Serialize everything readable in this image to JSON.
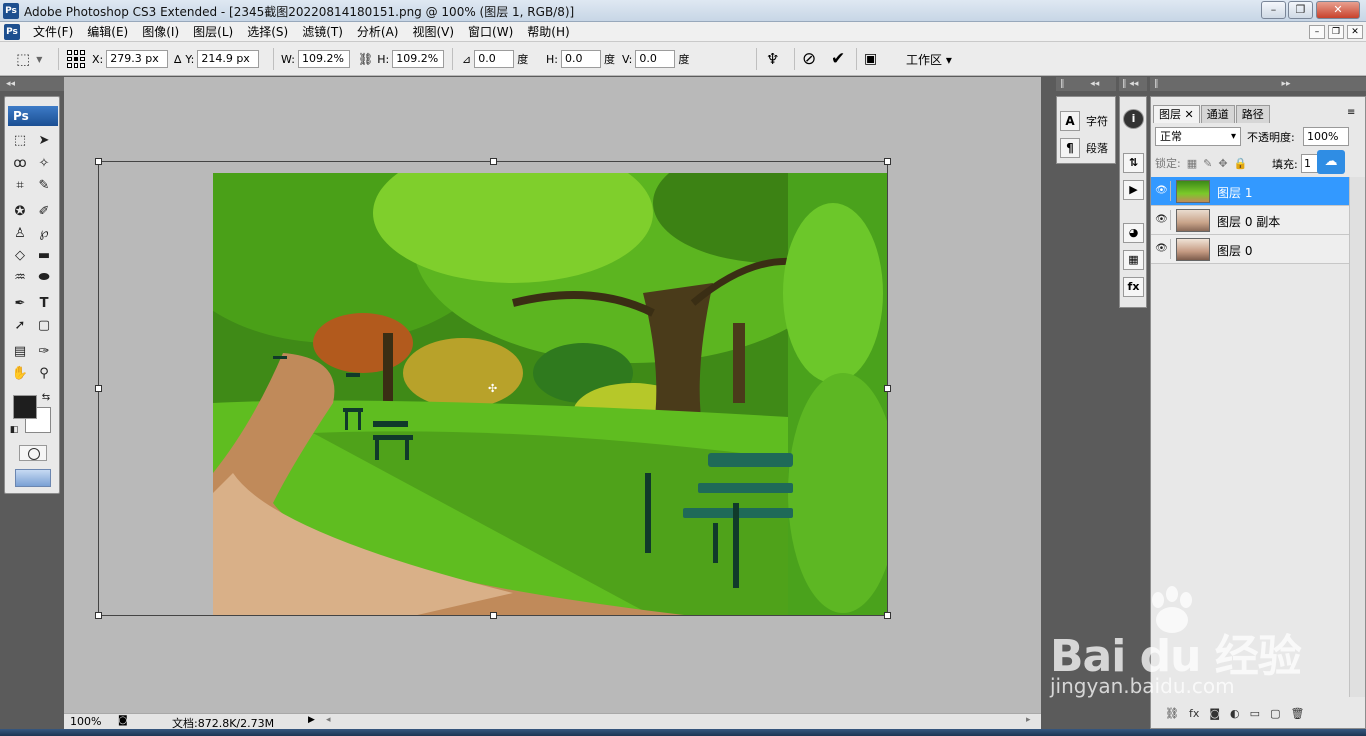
{
  "window": {
    "title": "Adobe Photoshop CS3 Extended - [2345截图20220814180151.png @ 100% (图层 1, RGB/8)]",
    "logo": "Ps"
  },
  "menu": [
    "文件(F)",
    "编辑(E)",
    "图像(I)",
    "图层(L)",
    "选择(S)",
    "滤镜(T)",
    "分析(A)",
    "视图(V)",
    "窗口(W)",
    "帮助(H)"
  ],
  "options": {
    "x_label": "X:",
    "x_value": "279.3 px",
    "y_label": "Y:",
    "y_value": "214.9 px",
    "w_label": "W:",
    "w_value": "109.2%",
    "h_label": "H:",
    "h_value": "109.2%",
    "angle_value": "0.0",
    "angle_unit": "度",
    "hskew_label": "H:",
    "hskew_value": "0.0",
    "hskew_unit": "度",
    "vskew_label": "V:",
    "vskew_value": "0.0",
    "vskew_unit": "度",
    "workspace_label": "工作区 ▾"
  },
  "toolbox": {
    "logo": "Ps"
  },
  "status": {
    "zoom": "100%",
    "doc": "文档:872.8K/2.73M"
  },
  "side_panel": {
    "char_label": "字符",
    "para_label": "段落"
  },
  "layers_panel": {
    "tabs": [
      "图层",
      "通道",
      "路径"
    ],
    "blend_mode": "正常",
    "opacity_label": "不透明度:",
    "opacity_value": "100%",
    "lock_label": "锁定:",
    "fill_label": "填充:",
    "fill_value": "1",
    "layers": [
      {
        "name": "图层 1",
        "selected": true
      },
      {
        "name": "图层 0 副本",
        "selected": false
      },
      {
        "name": "图层 0",
        "selected": false
      }
    ],
    "bottom_icons": [
      "link-icon",
      "fx-icon",
      "mask-icon",
      "adjustment-icon",
      "group-icon",
      "new-layer-icon",
      "trash-icon"
    ]
  },
  "watermark": {
    "brand": "Bai  du 经验",
    "site": "jingyan.baidu.com"
  },
  "colors": {
    "selected_layer": "#3399ff",
    "workspace_bg": "#b9b9b9",
    "toolbox_logo": "#1b4f93"
  }
}
